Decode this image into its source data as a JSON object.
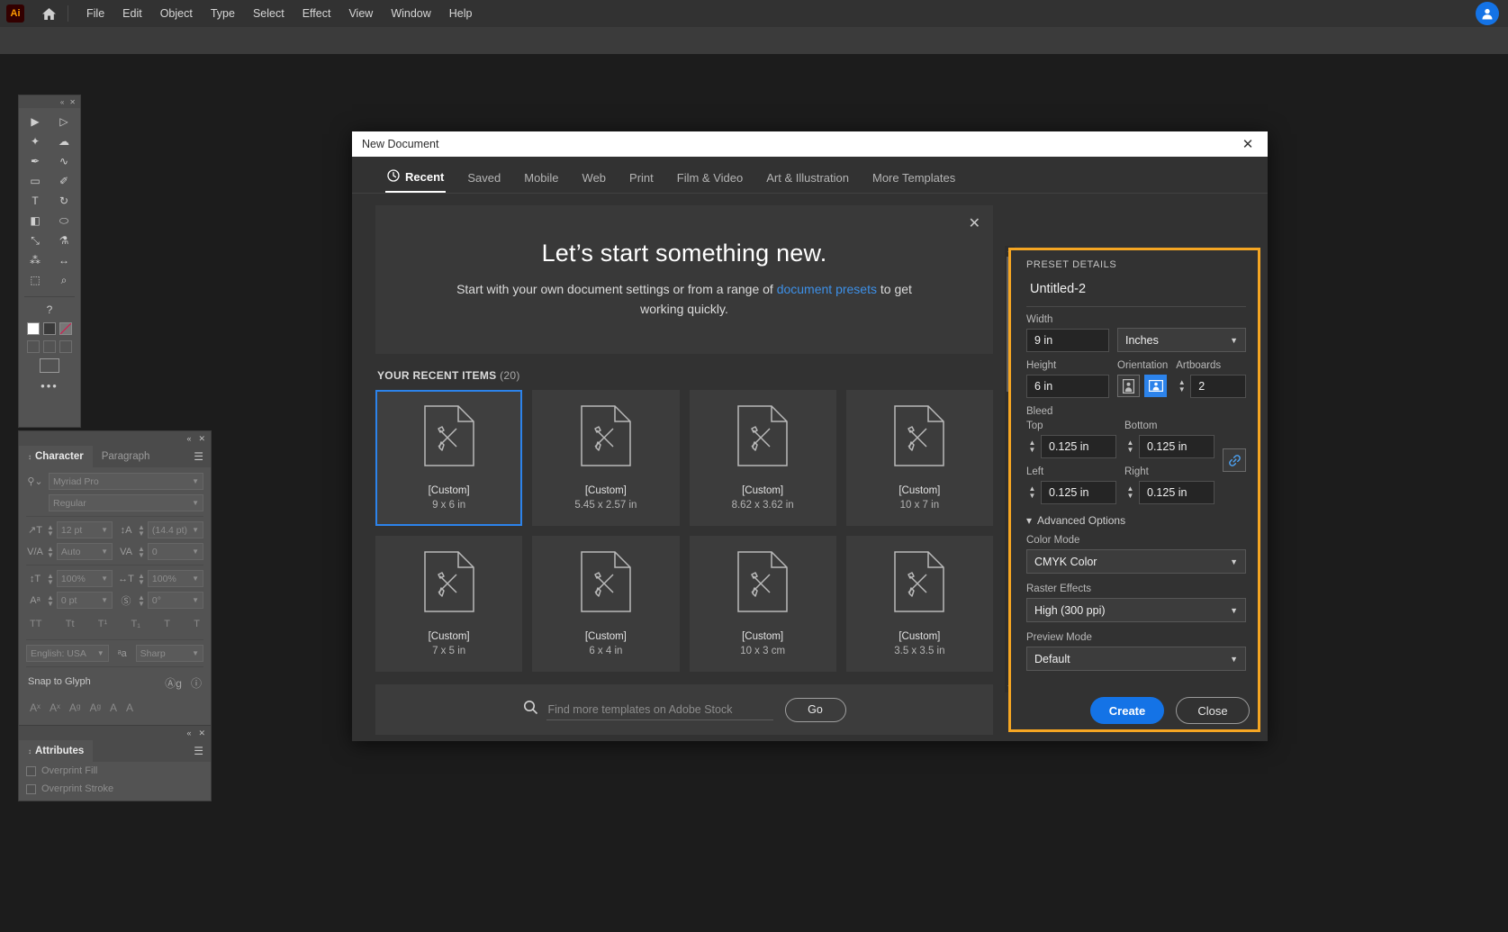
{
  "app": {
    "logo_text": "Ai",
    "menus": [
      "File",
      "Edit",
      "Object",
      "Type",
      "Select",
      "Effect",
      "View",
      "Window",
      "Help"
    ]
  },
  "tools": {
    "title": "Tools",
    "items": [
      {
        "name": "selection-tool",
        "glyph": "▶"
      },
      {
        "name": "direct-selection-tool",
        "glyph": "▷"
      },
      {
        "name": "magic-wand-tool",
        "glyph": "✦"
      },
      {
        "name": "lasso-tool",
        "glyph": "☁"
      },
      {
        "name": "pen-tool",
        "glyph": "✒"
      },
      {
        "name": "curvature-tool",
        "glyph": "∿"
      },
      {
        "name": "rectangle-tool",
        "glyph": "▭"
      },
      {
        "name": "paintbrush-tool",
        "glyph": "✐"
      },
      {
        "name": "type-tool",
        "glyph": "T"
      },
      {
        "name": "rotate-tool",
        "glyph": "↻"
      },
      {
        "name": "gradient-tool",
        "glyph": "◧"
      },
      {
        "name": "shaper-tool",
        "glyph": "⬭"
      },
      {
        "name": "scale-tool",
        "glyph": "⤡"
      },
      {
        "name": "eyedropper-tool",
        "glyph": "⚗"
      },
      {
        "name": "blend-tool",
        "glyph": "⁂"
      },
      {
        "name": "width-tool",
        "glyph": "↔"
      },
      {
        "name": "artboard-tool",
        "glyph": "⬚"
      },
      {
        "name": "zoom-tool",
        "glyph": "⌕"
      }
    ],
    "help_glyph": "?",
    "more_glyph": "•••"
  },
  "character_panel": {
    "tabs": [
      "Character",
      "Paragraph"
    ],
    "active_tab": "Character",
    "font_family": "Myriad Pro",
    "font_style": "Regular",
    "font_size": "12 pt",
    "leading": "(14.4 pt)",
    "kerning": "Auto",
    "tracking": "0",
    "vertical_scale": "100%",
    "horizontal_scale": "100%",
    "baseline_shift": "0 pt",
    "character_rotation": "0°",
    "language": "English: USA",
    "anti_aliasing": "Sharp",
    "snap_to_glyph_label": "Snap to Glyph",
    "style_buttons": [
      "TT",
      "Tt",
      "T¹",
      "T₁",
      "T",
      "T"
    ],
    "glyph_buttons": [
      "Aˣ",
      "Aˣ",
      "Aᵍ",
      "Aᵍ",
      "A",
      "A"
    ]
  },
  "attributes_panel": {
    "tab": "Attributes",
    "overprint_fill": "Overprint Fill",
    "overprint_stroke": "Overprint Stroke"
  },
  "dialog": {
    "title": "New Document",
    "close_glyph": "✕",
    "tabs": [
      {
        "label": "Recent",
        "icon": "clock-icon",
        "active": true
      },
      {
        "label": "Saved",
        "active": false
      },
      {
        "label": "Mobile",
        "active": false
      },
      {
        "label": "Web",
        "active": false
      },
      {
        "label": "Print",
        "active": false
      },
      {
        "label": "Film & Video",
        "active": false
      },
      {
        "label": "Art & Illustration",
        "active": false
      },
      {
        "label": "More Templates",
        "active": false
      }
    ],
    "hero": {
      "headline": "Let’s start something new.",
      "body_before": "Start with your own document settings or from a range of ",
      "link": "document presets",
      "body_after": " to get working quickly.",
      "close_glyph": "✕"
    },
    "recent": {
      "heading": "YOUR RECENT ITEMS",
      "count": "(20)",
      "items": [
        {
          "name": "[Custom]",
          "size": "9 x 6 in",
          "selected": true
        },
        {
          "name": "[Custom]",
          "size": "5.45 x 2.57 in",
          "selected": false
        },
        {
          "name": "[Custom]",
          "size": "8.62 x 3.62 in",
          "selected": false
        },
        {
          "name": "[Custom]",
          "size": "10 x 7 in",
          "selected": false
        },
        {
          "name": "[Custom]",
          "size": "7 x 5 in",
          "selected": false
        },
        {
          "name": "[Custom]",
          "size": "6 x 4 in",
          "selected": false
        },
        {
          "name": "[Custom]",
          "size": "10 x 3 cm",
          "selected": false
        },
        {
          "name": "[Custom]",
          "size": "3.5 x 3.5 in",
          "selected": false
        }
      ]
    },
    "stock": {
      "placeholder": "Find more templates on Adobe Stock",
      "go_label": "Go",
      "search_icon": "search-icon"
    },
    "preset": {
      "section_title": "PRESET DETAILS",
      "name": "Untitled-2",
      "width_label": "Width",
      "width_value": "9 in",
      "units_value": "Inches",
      "height_label": "Height",
      "height_value": "6 in",
      "orientation_label": "Orientation",
      "orientation_selected": "landscape",
      "artboards_label": "Artboards",
      "artboards_value": "2",
      "bleed_label": "Bleed",
      "bleed_top_label": "Top",
      "bleed_top_value": "0.125 in",
      "bleed_bottom_label": "Bottom",
      "bleed_bottom_value": "0.125 in",
      "bleed_left_label": "Left",
      "bleed_left_value": "0.125 in",
      "bleed_right_label": "Right",
      "bleed_right_value": "0.125 in",
      "link_icon": "link-icon",
      "advanced_label": "Advanced Options",
      "color_mode_label": "Color Mode",
      "color_mode_value": "CMYK Color",
      "raster_label": "Raster Effects",
      "raster_value": "High (300 ppi)",
      "preview_label": "Preview Mode",
      "preview_value": "Default",
      "highlight_color": "#f5a623"
    },
    "actions": {
      "create_label": "Create",
      "close_label": "Close",
      "create_color": "#1473e6"
    }
  }
}
